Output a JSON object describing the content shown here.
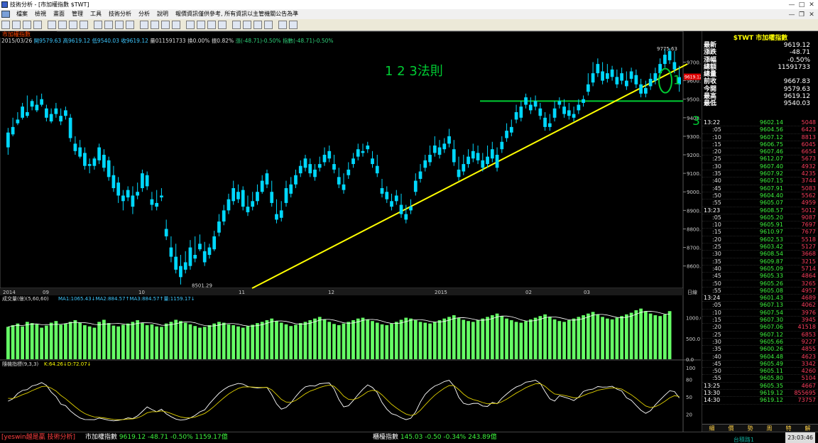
{
  "window": {
    "title": "技術分析 - [市加權指數 $TWT]"
  },
  "menu": [
    "檔案",
    "檢視",
    "畫面",
    "管理",
    "工具",
    "技術分析",
    "分析",
    "說明",
    "報價資訊僅供參考, 所有資訊以主管機關公告為準"
  ],
  "chart": {
    "panel_title": "市加權指數",
    "info": {
      "date": "2015/03/26",
      "open": "開9579.63",
      "high": "高9619.12",
      "low": "低9540.03",
      "close": "收9619.12",
      "vol": "量011591733",
      "chg": "換0.00%",
      "amp": "振0.82%",
      "diff": "漲(-48.71)-0.50%",
      "idx": "指數(-48.71)-0.50%"
    },
    "annotation": "1 2 3法則",
    "marks": [
      "1",
      "2",
      "3"
    ],
    "price_high_label": "9775.63",
    "price_low_label": "8501.29",
    "last_price_tag": "9619.12",
    "price_axis": [
      "9700.0",
      "9600.0",
      "9500.0",
      "9400.0",
      "9300.0",
      "9200.0",
      "9100.0",
      "9000.0",
      "8900.0",
      "8800.0",
      "8700.0",
      "8600.0"
    ],
    "date_axis": [
      "2014",
      "09",
      "10",
      "11",
      "12",
      "2015",
      "02",
      "03"
    ],
    "date_axis_right": "日線",
    "volume_title": "成交量(億)(5,60,60)",
    "volume_ma": "MA1:1065.43↓MA2:884.57↑MA3:884.57↑量:1159.17↓",
    "volume_axis": [
      "1000.0",
      "500.0",
      "0.0"
    ],
    "kd_title": "隨機指標(9,3,3)",
    "kd_values": "K:64.26↓D:72.07↓",
    "kd_axis": [
      "100",
      "80",
      "50",
      "20"
    ],
    "colors": {
      "up": "#e52e4e",
      "down": "#00d8ff",
      "support": "#00cc33",
      "trendline": "#ffff00",
      "vol_up": "#e0306a",
      "vol_down": "#66ff66",
      "k_line": "#ffffff",
      "d_line": "#e0d000"
    }
  },
  "chart_data": {
    "type": "candlestick",
    "title": "市加權指數",
    "ylim": [
      8480,
      9790
    ],
    "candles": [
      [
        9320,
        9345,
        9240,
        9200
      ],
      [
        9350,
        9400,
        9310,
        9300
      ],
      [
        9390,
        9430,
        9370,
        9360
      ],
      [
        9460,
        9480,
        9400,
        9390
      ],
      [
        9430,
        9520,
        9410,
        9400
      ],
      [
        9490,
        9500,
        9460,
        9440
      ],
      [
        9470,
        9520,
        9440,
        9430
      ],
      [
        9500,
        9530,
        9470,
        9460
      ],
      [
        9450,
        9470,
        9400,
        9380
      ],
      [
        9420,
        9450,
        9380,
        9370
      ],
      [
        9450,
        9480,
        9420,
        9400
      ],
      [
        9410,
        9450,
        9380,
        9360
      ],
      [
        9440,
        9460,
        9410,
        9390
      ],
      [
        9400,
        9420,
        9290,
        9270
      ],
      [
        9260,
        9300,
        9220,
        9200
      ],
      [
        9240,
        9280,
        9190,
        9180
      ],
      [
        9210,
        9240,
        9140,
        9120
      ],
      [
        9150,
        9180,
        9140,
        9100
      ],
      [
        9180,
        9190,
        9140,
        9120
      ],
      [
        9240,
        9260,
        9170,
        9150
      ],
      [
        9200,
        9230,
        9130,
        9110
      ],
      [
        9170,
        9190,
        9080,
        9060
      ],
      [
        9090,
        9140,
        9020,
        9000
      ],
      [
        9050,
        9080,
        8980,
        8940
      ],
      [
        8980,
        9010,
        8950,
        8900
      ],
      [
        9010,
        9030,
        8970,
        8950
      ],
      [
        8980,
        9030,
        8920,
        8880
      ],
      [
        9000,
        9050,
        8980,
        8960
      ],
      [
        9100,
        9120,
        9020,
        9000
      ],
      [
        9090,
        9110,
        9030,
        9010
      ],
      [
        8960,
        9000,
        8930,
        8900
      ],
      [
        8940,
        9010,
        8920,
        8900
      ],
      [
        8980,
        9020,
        8970,
        8950
      ],
      [
        8800,
        8850,
        8760,
        8740
      ],
      [
        8700,
        8760,
        8650,
        8620
      ],
      [
        8650,
        8720,
        8580,
        8560
      ],
      [
        8600,
        8660,
        8540,
        8500
      ],
      [
        8620,
        8680,
        8580,
        8560
      ],
      [
        8700,
        8740,
        8600,
        8580
      ],
      [
        8660,
        8760,
        8640,
        8620
      ],
      [
        8720,
        8770,
        8690,
        8680
      ],
      [
        8680,
        8730,
        8620,
        8600
      ],
      [
        8700,
        8720,
        8660,
        8640
      ],
      [
        8760,
        8790,
        8690,
        8680
      ],
      [
        8840,
        8880,
        8780,
        8760
      ],
      [
        8900,
        8930,
        8840,
        8820
      ],
      [
        8960,
        8990,
        8900,
        8880
      ],
      [
        9020,
        9060,
        8950,
        8930
      ],
      [
        9000,
        9040,
        8960,
        8940
      ],
      [
        9010,
        9030,
        8920,
        8900
      ],
      [
        8920,
        8980,
        8890,
        8870
      ],
      [
        8950,
        9000,
        8920,
        8900
      ],
      [
        9000,
        9040,
        8950,
        8930
      ],
      [
        9060,
        9090,
        9000,
        8990
      ],
      [
        9100,
        9120,
        9040,
        9020
      ],
      [
        9000,
        9060,
        8940,
        8920
      ],
      [
        8880,
        8960,
        8850,
        8830
      ],
      [
        8900,
        8950,
        8860,
        8840
      ],
      [
        9020,
        9060,
        8940,
        8920
      ],
      [
        9040,
        9080,
        8990,
        8970
      ],
      [
        9090,
        9120,
        9040,
        9020
      ],
      [
        9140,
        9170,
        9100,
        9080
      ],
      [
        9180,
        9200,
        9130,
        9110
      ],
      [
        9150,
        9180,
        9100,
        9080
      ],
      [
        9120,
        9150,
        9080,
        9060
      ],
      [
        9150,
        9190,
        9130,
        9110
      ],
      [
        9200,
        9240,
        9160,
        9140
      ],
      [
        9220,
        9250,
        9180,
        9160
      ],
      [
        9150,
        9200,
        9120,
        9100
      ],
      [
        9080,
        9130,
        9040,
        9020
      ],
      [
        9040,
        9100,
        9010,
        8990
      ],
      [
        9120,
        9160,
        9090,
        9070
      ],
      [
        9180,
        9210,
        9150,
        9130
      ],
      [
        9230,
        9260,
        9190,
        9170
      ],
      [
        9220,
        9260,
        9210,
        9190
      ],
      [
        9250,
        9270,
        9230,
        9210
      ],
      [
        9180,
        9220,
        9150,
        9130
      ],
      [
        9140,
        9200,
        9100,
        9080
      ],
      [
        9020,
        9070,
        8990,
        8970
      ],
      [
        9000,
        9030,
        8960,
        8940
      ],
      [
        8950,
        8990,
        8920,
        8900
      ],
      [
        8980,
        9010,
        8950,
        8930
      ],
      [
        8930,
        8990,
        8880,
        8860
      ],
      [
        8880,
        8930,
        8850,
        8830
      ],
      [
        8920,
        8960,
        8900,
        8880
      ],
      [
        9060,
        9100,
        9000,
        8980
      ],
      [
        9110,
        9150,
        9070,
        9050
      ],
      [
        9170,
        9200,
        9130,
        9110
      ],
      [
        9200,
        9250,
        9160,
        9140
      ],
      [
        9250,
        9300,
        9210,
        9190
      ],
      [
        9240,
        9280,
        9200,
        9180
      ],
      [
        9260,
        9290,
        9230,
        9210
      ],
      [
        9300,
        9340,
        9260,
        9240
      ],
      [
        9230,
        9280,
        9160,
        9140
      ],
      [
        9120,
        9190,
        9080,
        9060
      ],
      [
        9150,
        9200,
        9110,
        9090
      ],
      [
        9190,
        9230,
        9150,
        9130
      ],
      [
        9220,
        9260,
        9180,
        9160
      ],
      [
        9210,
        9250,
        9170,
        9150
      ],
      [
        9170,
        9210,
        9130,
        9110
      ],
      [
        9190,
        9250,
        9150,
        9130
      ],
      [
        9230,
        9270,
        9180,
        9160
      ],
      [
        9200,
        9240,
        9130,
        9110
      ],
      [
        9270,
        9300,
        9230,
        9210
      ],
      [
        9330,
        9370,
        9290,
        9270
      ],
      [
        9350,
        9390,
        9320,
        9300
      ],
      [
        9430,
        9470,
        9390,
        9370
      ],
      [
        9460,
        9490,
        9400,
        9380
      ],
      [
        9510,
        9530,
        9470,
        9450
      ],
      [
        9470,
        9510,
        9440,
        9420
      ],
      [
        9490,
        9520,
        9460,
        9440
      ],
      [
        9450,
        9480,
        9410,
        9390
      ],
      [
        9400,
        9430,
        9350,
        9330
      ],
      [
        9370,
        9420,
        9350,
        9330
      ],
      [
        9450,
        9490,
        9400,
        9380
      ],
      [
        9490,
        9510,
        9470,
        9450
      ],
      [
        9460,
        9500,
        9420,
        9400
      ],
      [
        9440,
        9480,
        9410,
        9390
      ],
      [
        9420,
        9460,
        9400,
        9380
      ],
      [
        9470,
        9500,
        9440,
        9420
      ],
      [
        9500,
        9520,
        9480,
        9460
      ],
      [
        9580,
        9640,
        9540,
        9520
      ],
      [
        9640,
        9700,
        9590,
        9570
      ],
      [
        9690,
        9720,
        9640,
        9620
      ],
      [
        9650,
        9700,
        9600,
        9580
      ],
      [
        9640,
        9690,
        9610,
        9590
      ],
      [
        9660,
        9680,
        9620,
        9600
      ],
      [
        9620,
        9660,
        9580,
        9560
      ],
      [
        9640,
        9670,
        9600,
        9580
      ],
      [
        9600,
        9650,
        9570,
        9550
      ],
      [
        9650,
        9670,
        9610,
        9590
      ],
      [
        9630,
        9660,
        9580,
        9560
      ],
      [
        9580,
        9610,
        9530,
        9510
      ],
      [
        9560,
        9600,
        9530,
        9510
      ],
      [
        9610,
        9640,
        9570,
        9550
      ],
      [
        9640,
        9670,
        9600,
        9580
      ],
      [
        9690,
        9720,
        9640,
        9620
      ],
      [
        9740,
        9770,
        9690,
        9670
      ],
      [
        9760,
        9775,
        9710,
        9690
      ],
      [
        9700,
        9760,
        9660,
        9640
      ],
      [
        9619,
        9680,
        9580,
        9540
      ]
    ],
    "volume": [
      780,
      820,
      860,
      790,
      900,
      870,
      840,
      760,
      810,
      880,
      920,
      830,
      860,
      900,
      940,
      880,
      820,
      790,
      760,
      900,
      950,
      870,
      810,
      790,
      830,
      860,
      900,
      940,
      870,
      820,
      840,
      790,
      780,
      860,
      900,
      950,
      920,
      880,
      840,
      800,
      760,
      780,
      820,
      860,
      900,
      880,
      840,
      820,
      790,
      760,
      800,
      830,
      870,
      900,
      940,
      980,
      920,
      880,
      840,
      800,
      830,
      870,
      900,
      940,
      980,
      1020,
      960,
      900,
      850,
      820,
      860,
      900,
      940,
      980,
      1000,
      960,
      920,
      880,
      840,
      820,
      860,
      900,
      950,
      1000,
      980,
      940,
      900,
      880,
      860,
      900,
      940,
      980,
      1020,
      1060,
      1000,
      950,
      920,
      900,
      940,
      980,
      1020,
      1060,
      1100,
      1040,
      980,
      940,
      900,
      880,
      920,
      960,
      1000,
      1040,
      1080,
      1020,
      960,
      920,
      900,
      940,
      980,
      1020,
      1060,
      1100,
      1140,
      1080,
      1020,
      980,
      960,
      1000,
      1040,
      1080,
      1120,
      1180,
      1220,
      1160,
      1100,
      1060,
      1040,
      1080,
      1159
    ]
  },
  "quote": [
    {
      "k": "最新",
      "v": "9619.12"
    },
    {
      "k": "漲跌",
      "v": "-48.71"
    },
    {
      "k": "漲幅",
      "v": "-0.50%"
    },
    {
      "k": "總額",
      "v": "11591733"
    },
    {
      "k": "總量",
      "v": ""
    },
    {
      "k": "前收",
      "v": "9667.83"
    },
    {
      "k": "今開",
      "v": "9579.63"
    },
    {
      "k": "最高",
      "v": "9619.12"
    },
    {
      "k": "最低",
      "v": "9540.03"
    }
  ],
  "right_header": {
    "code": "$TWT",
    "name": "市加權指數"
  },
  "ticks": [
    {
      "t": "13:22",
      "s": false,
      "p": "9602.14",
      "v": "5048"
    },
    {
      "t": ":05",
      "s": true,
      "p": "9604.56",
      "v": "6423"
    },
    {
      "t": ":10",
      "s": true,
      "p": "9607.12",
      "v": "8813"
    },
    {
      "t": ":15",
      "s": true,
      "p": "9606.75",
      "v": "6045"
    },
    {
      "t": ":20",
      "s": true,
      "p": "9607.46",
      "v": "6654"
    },
    {
      "t": ":25",
      "s": true,
      "p": "9612.07",
      "v": "5673"
    },
    {
      "t": ":30",
      "s": true,
      "p": "9607.40",
      "v": "4932"
    },
    {
      "t": ":35",
      "s": true,
      "p": "9607.92",
      "v": "4235"
    },
    {
      "t": ":40",
      "s": true,
      "p": "9607.15",
      "v": "3744"
    },
    {
      "t": ":45",
      "s": true,
      "p": "9607.91",
      "v": "5083"
    },
    {
      "t": ":50",
      "s": true,
      "p": "9604.40",
      "v": "5562"
    },
    {
      "t": ":55",
      "s": true,
      "p": "9605.07",
      "v": "4959"
    },
    {
      "t": "13:23",
      "s": false,
      "p": "9608.57",
      "v": "5012"
    },
    {
      "t": ":05",
      "s": true,
      "p": "9605.20",
      "v": "9087"
    },
    {
      "t": ":10",
      "s": true,
      "p": "9605.91",
      "v": "7697"
    },
    {
      "t": ":15",
      "s": true,
      "p": "9610.97",
      "v": "7677"
    },
    {
      "t": ":20",
      "s": true,
      "p": "9602.53",
      "v": "5518"
    },
    {
      "t": ":25",
      "s": true,
      "p": "9603.42",
      "v": "5127"
    },
    {
      "t": ":30",
      "s": true,
      "p": "9608.54",
      "v": "3668"
    },
    {
      "t": ":35",
      "s": true,
      "p": "9609.87",
      "v": "3215"
    },
    {
      "t": ":40",
      "s": true,
      "p": "9605.09",
      "v": "5714"
    },
    {
      "t": ":45",
      "s": true,
      "p": "9605.33",
      "v": "4864"
    },
    {
      "t": ":50",
      "s": true,
      "p": "9605.26",
      "v": "3265"
    },
    {
      "t": ":55",
      "s": true,
      "p": "9605.08",
      "v": "4957"
    },
    {
      "t": "13:24",
      "s": false,
      "p": "9601.43",
      "v": "4689"
    },
    {
      "t": ":05",
      "s": true,
      "p": "9607.13",
      "v": "4062"
    },
    {
      "t": ":10",
      "s": true,
      "p": "9607.54",
      "v": "3976"
    },
    {
      "t": ":15",
      "s": true,
      "p": "9607.30",
      "v": "3945"
    },
    {
      "t": ":20",
      "s": true,
      "p": "9607.06",
      "v": "41518"
    },
    {
      "t": ":25",
      "s": true,
      "p": "9607.12",
      "v": "6853"
    },
    {
      "t": ":30",
      "s": true,
      "p": "9605.66",
      "v": "9227"
    },
    {
      "t": ":35",
      "s": true,
      "p": "9600.26",
      "v": "4855"
    },
    {
      "t": ":40",
      "s": true,
      "p": "9604.48",
      "v": "4623"
    },
    {
      "t": ":45",
      "s": true,
      "p": "9605.49",
      "v": "3342"
    },
    {
      "t": ":50",
      "s": true,
      "p": "9605.11",
      "v": "4260"
    },
    {
      "t": ":55",
      "s": true,
      "p": "9605.80",
      "v": "5104"
    },
    {
      "t": "13:25",
      "s": false,
      "p": "9605.35",
      "v": "4667"
    },
    {
      "t": "13:30",
      "s": false,
      "p": "9619.12",
      "v": "855695"
    },
    {
      "t": "14:30",
      "s": false,
      "p": "9619.12",
      "v": "73757"
    }
  ],
  "right_tabs": [
    "細",
    "價",
    "勢",
    "周",
    "特",
    "解"
  ],
  "status": {
    "brand": "[yeswin越是贏 技術分析]",
    "idx1_name": "市加權指數",
    "idx1_val": "9619.12 -48.71 -0.50% 1159.17億",
    "idx2_name": "櫃檯指數",
    "idx2_val": "145.03 -0.50 -0.34% 243.89億",
    "light": "台積路1",
    "time": "23:03:46"
  }
}
